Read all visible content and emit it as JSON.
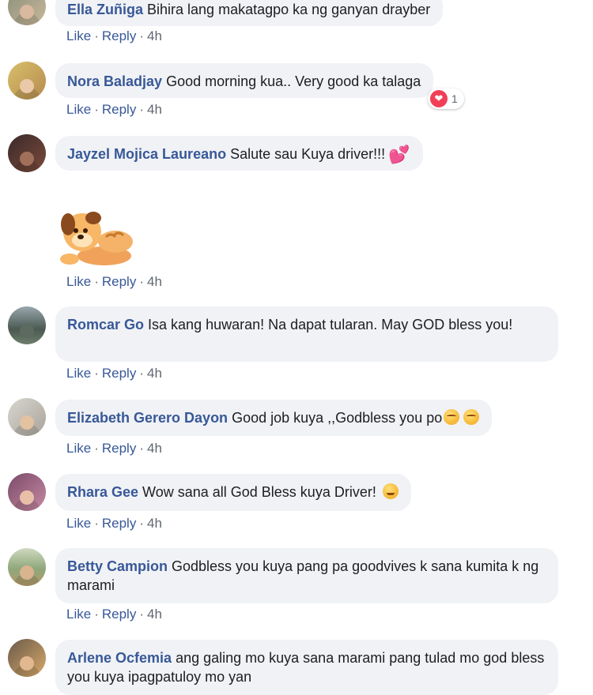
{
  "actions": {
    "like": "Like",
    "reply": "Reply",
    "sep": "·"
  },
  "comments": [
    {
      "author": "Ella Zuñiga",
      "text": "Bihira lang makatagpo ka ng ganyan drayber",
      "time": "4h"
    },
    {
      "author": "Nora Baladjay",
      "text": "Good morning kua.. Very good ka talaga",
      "time": "4h",
      "reaction_count": "1"
    },
    {
      "author": "Jayzel Mojica Laureano",
      "text": "Salute sau Kuya driver!!!",
      "time": "4h"
    },
    {
      "author": "Romcar Go",
      "text": "Isa kang huwaran! Na dapat tularan. May GOD bless you!",
      "time": "4h"
    },
    {
      "author": "Elizabeth Gerero Dayon",
      "text": "Good job kuya ,,Godbless you po",
      "time": "4h"
    },
    {
      "author": "Rhara Gee",
      "text": "Wow sana all God Bless kuya Driver!",
      "time": "4h"
    },
    {
      "author": "Betty Campion",
      "text": "Godbless you kuya pang pa goodvives k sana kumita k ng marami",
      "time": "4h"
    },
    {
      "author": "Arlene Ocfemia",
      "text": "ang galing mo kuya sana marami pang tulad mo god bless you kuya ipagpatuloy mo yan"
    }
  ],
  "icons": {
    "reaction": "heart-icon",
    "sticker": "dog-sticker",
    "emoji_hearts": "two-hearts-icon",
    "emoji_relieved": "relieved-face-icon",
    "emoji_wink": "winking-face-icon"
  },
  "colors": {
    "author": "#385898",
    "bubble": "#f0f2f5",
    "text": "#1c1e21",
    "meta": "#606770",
    "heart": "#f33e58"
  }
}
